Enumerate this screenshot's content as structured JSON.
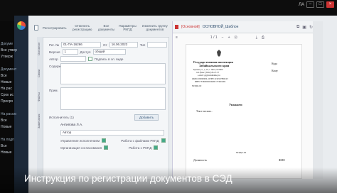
{
  "window": {
    "user_label": "ЛА",
    "min_label": "–",
    "max_label": "□",
    "close_label": "×"
  },
  "toolbar": {
    "btn1": "Регистрировать",
    "btn2": "Отменить регистрацию",
    "btn3": "Все документы",
    "btn4": "Параметры РКПД",
    "btn5": "Изменить группу документов"
  },
  "sidebar": {
    "items": [
      "Докуме",
      "Все утвер",
      "Утверж",
      "",
      "Документ",
      "Все",
      "Новые",
      "На рас",
      "Срок ис",
      "Просро",
      "",
      "На рассм",
      "Все",
      "Новые",
      "",
      "На подп",
      "Все",
      "Новые"
    ]
  },
  "vtabs": [
    "Основное",
    "Связи",
    "Файлы",
    "Замечания"
  ],
  "form": {
    "reg_no_label": "Рег. №",
    "reg_no_value": "01-ПА-16266",
    "date_label": "От",
    "date_value": "16.06.2023",
    "kind_label": "Тип",
    "version_label": "Версия",
    "version_value": "1",
    "access_label": "Доступ",
    "access_value": "общий",
    "author_label": "Автор",
    "sign_label": "Подпись в эл. виде",
    "summary_label": "Содерж.",
    "note_label": "Прим.",
    "executors_label": "Исполнитель (1)",
    "add_button": "Добавить",
    "person": "Антипова Л.А.",
    "role": "Автор",
    "opt1": "Управление исполнением",
    "opt2": "Работа с файлами РКПД",
    "opt3": "Организация согласования",
    "opt4": "Работа с РКПД"
  },
  "pdf": {
    "title_red": "[Основной]",
    "title_doc": "ОСНОВНОЙ_Шаблон",
    "page_indicator": "1 / 1",
    "org_line1": "Государственная инспекция",
    "org_line2": "Забайкальского края",
    "addr1": "Бутина ул., д. 10, г. Чита, 672000",
    "addr2": "тел./факс (3022) 26-27-37",
    "addr3": "e-mail: gi@zabaikalsky.ru",
    "addr4": "ОКПО 00000000, ОГРН 1234567890123",
    "addr5": "ИНН 7536000000/КПП 753601001",
    "reg_stamp": "МЭДО-02",
    "recip_label": "Кому",
    "to_label": "Куда",
    "salute": "Уважаем",
    "body": "Текст письма...",
    "sign_reg": "МЭДО-02",
    "footer_left": "Должность",
    "footer_right": "ФИО"
  },
  "caption": {
    "text": "Инструкция по регистрации документов в СЭД"
  },
  "colors": {
    "accent_red": "#cc3333",
    "nav_dark": "#1d2a3a",
    "caption_text": "#ffffff"
  }
}
